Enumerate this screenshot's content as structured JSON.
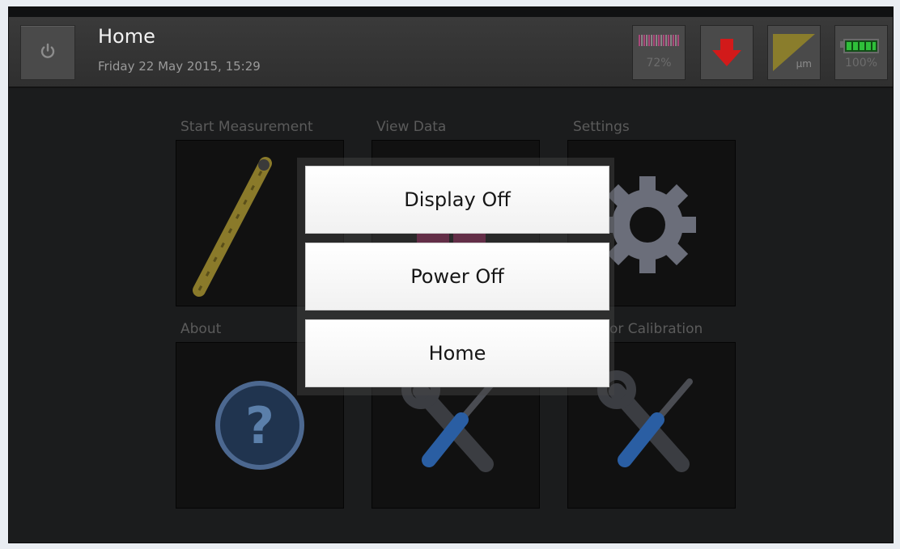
{
  "header": {
    "title": "Home",
    "date": "Friday 22 May 2015, 15:29",
    "power_icon": "power-icon"
  },
  "status": {
    "signal_text": "72%",
    "arrow_icon": "download-arrow-icon",
    "unit_text": "µm",
    "battery_text": "100%"
  },
  "tiles": [
    {
      "label": "Start Measurement",
      "icon": "probe-icon"
    },
    {
      "label": "View Data",
      "icon": "data-icon"
    },
    {
      "label": "Settings",
      "icon": "gear-icon"
    },
    {
      "label": "About",
      "icon": "question-icon"
    },
    {
      "label": "",
      "icon": "wrench-screwdriver-icon"
    },
    {
      "label": "or Calibration",
      "icon": "wrench-screwdriver-icon"
    }
  ],
  "menu": {
    "display_off": "Display Off",
    "power_off": "Power Off",
    "home": "Home"
  },
  "colors": {
    "background": "#1b1c1d",
    "header": "#353535",
    "menu_button": "#f6f6f6",
    "arrow": "#d21a1a",
    "battery": "#2fbf3a",
    "signal": "#b2477e"
  }
}
